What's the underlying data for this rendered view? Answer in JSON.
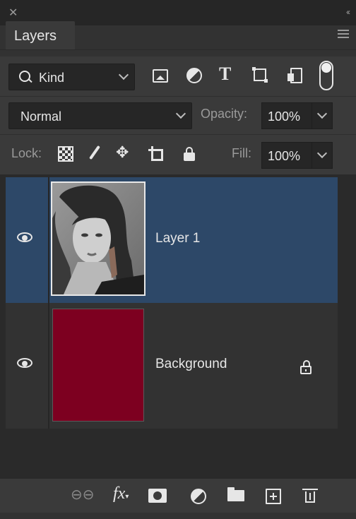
{
  "panel": {
    "title": "Layers",
    "icons": {
      "close": "close-icon",
      "collapse": "double-chevron-icon",
      "menu": "panel-menu-icon"
    }
  },
  "filter": {
    "kind_label": "Kind",
    "icons": [
      "image-filter-icon",
      "adjustment-filter-icon",
      "type-filter-icon",
      "shape-filter-icon",
      "smart-object-filter-icon",
      "filter-toggle-icon"
    ]
  },
  "blend": {
    "mode": "Normal",
    "opacity_label": "Opacity:",
    "opacity_value": "100%"
  },
  "lock": {
    "label": "Lock:",
    "icons": [
      "lock-pixels-icon",
      "lock-brush-icon",
      "lock-position-icon",
      "lock-artboard-icon",
      "lock-all-icon"
    ],
    "fill_label": "Fill:",
    "fill_value": "100%"
  },
  "layers": [
    {
      "name": "Layer 1",
      "visible": true,
      "selected": true,
      "thumbnail": "portrait-photo"
    },
    {
      "name": "Background",
      "visible": true,
      "selected": false,
      "locked": true,
      "color": "#7d0020"
    }
  ],
  "footer": {
    "icons": [
      "link-layers-icon",
      "fx-icon",
      "layer-mask-icon",
      "adjustment-layer-icon",
      "group-folder-icon",
      "new-layer-icon",
      "trash-icon"
    ]
  },
  "colors": {
    "selected_row": "#2d4868",
    "panel_bg": "#323232",
    "background_layer_fill": "#7d0020"
  }
}
